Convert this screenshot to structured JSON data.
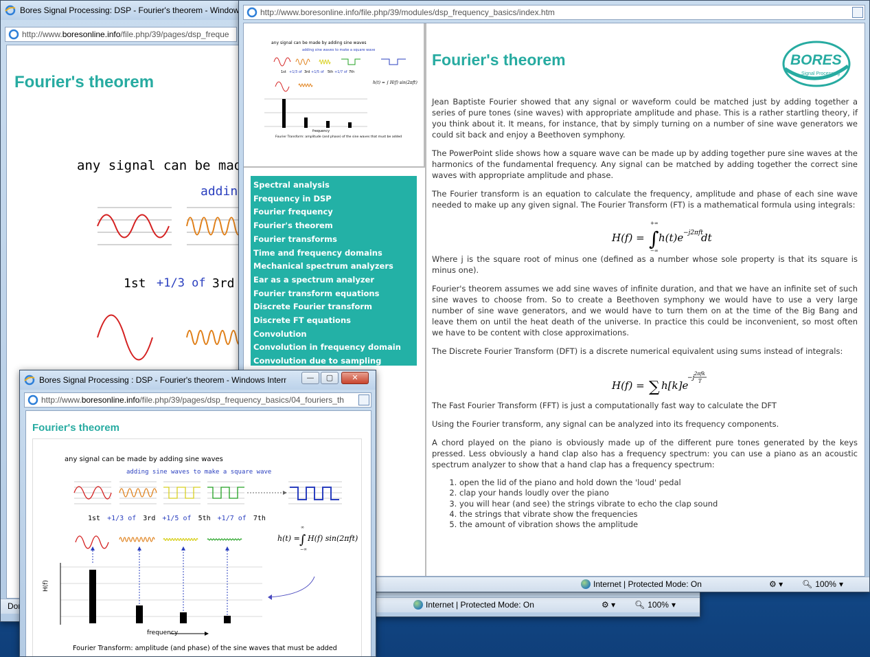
{
  "page_title": "Fourier's theorem",
  "win_back": {
    "title": "Bores Signal Processing: DSP - Fourier's theorem - Window",
    "url_prefix": "http://www.",
    "url_domain": "boresonline.info",
    "url_rest": "/file.php/39/pages/dsp_freque",
    "slide_headline": "any signal can be made b",
    "slide_adding": "adding",
    "slide_1st": "1st",
    "slide_plus": "+1/3 of",
    "slide_3rd": "3rd",
    "status_left": "Don"
  },
  "win_small": {
    "title": "Bores Signal Processing : DSP - Fourier's theorem - Windows Interne...",
    "url_prefix": "http://www.",
    "url_domain": "boresonline.info",
    "url_rest": "/file.php/39/pages/dsp_frequency_basics/04_fouriers_th",
    "status_zone": "Internet | Protected Mode: On",
    "zoom": "100%"
  },
  "slide": {
    "line1": "any signal can be made by adding sine waves",
    "line2": "adding sine waves to make a square wave",
    "h_1st": "1st",
    "h_p3": "+1/3 of",
    "h_3rd": "3rd",
    "h_p5": "+1/5 of",
    "h_5th": "5th",
    "h_p7": "+1/7 of",
    "h_7th": "7th",
    "ylabel": "H(f)",
    "xlabel": "frequency",
    "caption": "Fourier Transform: amplitude (and phase) of the sine waves that must be added",
    "eq_lhs": "h(t) =",
    "eq_rhs": "H(f) sin(2πft)"
  },
  "win_front": {
    "url": "http://www.boresonline.info/file.php/39/modules/dsp_frequency_basics/index.htm",
    "logo_text": "BORES",
    "logo_sub": "Signal Processing",
    "status_zone": "Internet | Protected Mode: On",
    "zoom": "100%"
  },
  "nav_items": [
    "Spectral analysis",
    "Frequency in DSP",
    "Fourier frequency",
    "Fourier's theorem",
    "Fourier transforms",
    "Time and frequency domains",
    "Mechanical spectrum analyzers",
    "Ear as a spectrum analyzer",
    "Fourier transform equations",
    "Discrete Fourier transform",
    "Discrete FT equations",
    "Convolution",
    "Convolution in frequency domain",
    "Convolution due to sampling"
  ],
  "article": {
    "p1": "Jean Baptiste Fourier showed that any signal or waveform could be matched just by adding together a series of pure tones (sine waves) with appropriate amplitude and phase. This is a rather startling theory, if you think about it. It means, for instance, that by simply turning on a number of sine wave generators we could sit back and enjoy a Beethoven symphony.",
    "p2": "The PowerPoint slide shows how a square wave can be made up by adding together pure sine waves at the harmonics of the fundamental frequency. Any signal can be matched by adding together the correct sine waves with appropriate amplitude and phase.",
    "p3": "The Fourier transform is an equation to calculate the frequency, amplitude and phase of each sine wave needed to make up any given signal. The Fourier Transform (FT) is a mathematical formula using integrals:",
    "eq1": "H(f) = ∫ h(t)e^(-j2πft) dt",
    "p4": "Where j is the square root of minus one (defined as a number whose sole property is that its square is minus one).",
    "p5": "Fourier's theorem assumes we add sine waves of infinite duration, and that we have an infinite set of such sine waves to choose from. So to create a Beethoven symphony we would have to use a very large number of sine wave generators, and we would have to turn them on at the time of the Big Bang and leave them on until the heat death of the universe. In practice this could be inconvenient, so most often we have to be content with close approximations.",
    "p6": "The Discrete Fourier Transform (DFT) is a discrete numerical equivalent using sums instead of integrals:",
    "p7": "The Fast Fourier Transform (FFT) is just a computationally fast way to calculate the DFT",
    "p8": "Using the Fourier transform, any signal can be analyzed into its frequency components.",
    "p9": "A chord played on the piano is obviously made up of the different pure tones generated by the keys pressed. Less obviously a hand clap also has a frequency spectrum: you can use a piano as an acoustic spectrum analyzer to show that a hand clap has a frequency spectrum:",
    "steps": [
      "open the lid of the piano and hold down the 'loud' pedal",
      "clap your hands loudly over the piano",
      "you will hear (and see) the strings vibrate to echo the clap sound",
      "the strings that vibrate show the frequencies",
      "the amount of vibration shows the amplitude"
    ]
  },
  "colors": {
    "accent": "#27aba1",
    "nav_bg": "#23b1a6",
    "sine_1st": "#d42020",
    "sine_3rd": "#e0801a",
    "sine_5th": "#d8d020",
    "sine_7th": "#20a020",
    "square": "#2a3fbf"
  }
}
